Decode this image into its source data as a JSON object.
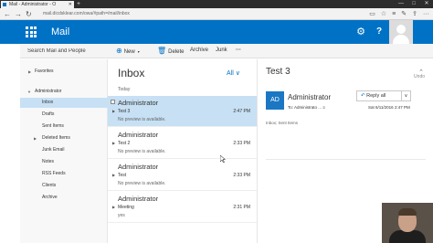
{
  "browser": {
    "tab_title": "Mail - Administrator - O",
    "new_tab_glyph": "+",
    "address": "mail.dicdsklear.com/owa/#path=/mail/inbox",
    "window_buttons": [
      "—",
      "□",
      "✕"
    ],
    "nav_icons": [
      "back-icon",
      "forward-icon",
      "refresh-icon"
    ],
    "toolbar_icons": [
      "reading-view-icon",
      "favorites-icon",
      "hub-icon",
      "notes-icon",
      "share-icon",
      "more-icon"
    ]
  },
  "app": {
    "name": "Mail",
    "accent_color": "#0072c6",
    "gear_glyph": "⚙",
    "help_glyph": "?"
  },
  "search": {
    "placeholder": "Search Mail and People"
  },
  "commands": {
    "new_label": "New",
    "delete_label": "Delete",
    "archive_label": "Archive",
    "junk_label": "Junk",
    "more_label": "···"
  },
  "folders": {
    "favorites": "Favorites",
    "account": "Administrator",
    "items": [
      {
        "label": "Inbox"
      },
      {
        "label": "Drafts"
      },
      {
        "label": "Sent Items"
      },
      {
        "label": "Deleted Items"
      },
      {
        "label": "Junk Email"
      },
      {
        "label": "Notes"
      },
      {
        "label": "RSS Feeds"
      },
      {
        "label": "Clients"
      },
      {
        "label": "Archive"
      }
    ]
  },
  "list": {
    "title": "Inbox",
    "filter_label": "All ∨",
    "group_today": "Today",
    "messages": [
      {
        "from": "Administrator",
        "subject": "Test 3",
        "preview": "No preview is available.",
        "time": "2:47 PM"
      },
      {
        "from": "Administrator",
        "subject": "Test 2",
        "preview": "No preview is available.",
        "time": "2:33 PM"
      },
      {
        "from": "Administrator",
        "subject": "Test",
        "preview": "No preview is available.",
        "time": "2:33 PM"
      },
      {
        "from": "Administrator",
        "subject": "Meeting",
        "preview": "yes",
        "time": "2:31 PM"
      }
    ]
  },
  "reading": {
    "subject": "Test 3",
    "undo_label": "Undo",
    "avatar_initials": "AD",
    "from": "Administrator",
    "to_line": "To:  Administrato ... ≡",
    "reply_all_label": "Reply all",
    "date": "Sat 6/11/2016 2:47 PM",
    "folders_line": "Inbox; Sent Items"
  }
}
